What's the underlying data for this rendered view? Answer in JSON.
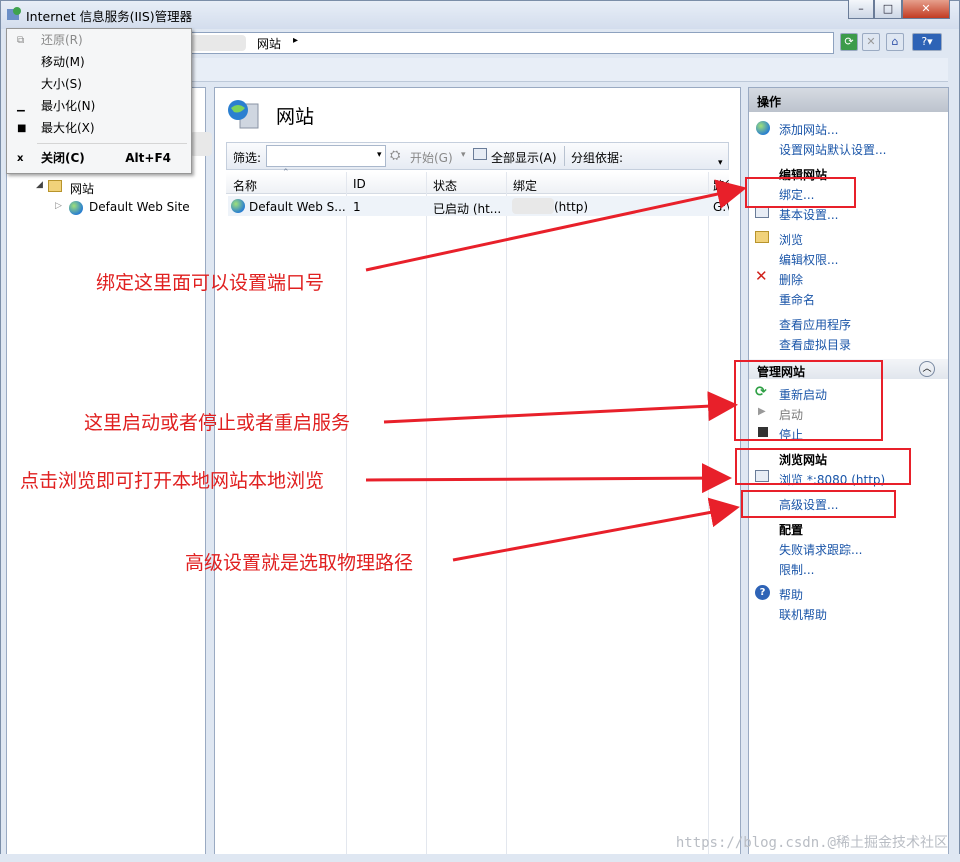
{
  "window": {
    "title": "Internet 信息服务(IIS)管理器",
    "min": "–",
    "max": "□",
    "close": "✕"
  },
  "context_menu": {
    "items": [
      {
        "label": "还原(R)",
        "icon": "⧉",
        "disabled": true
      },
      {
        "label": "移动(M)",
        "icon": ""
      },
      {
        "label": "大小(S)",
        "icon": ""
      },
      {
        "label": "最小化(N)",
        "icon": "▁"
      },
      {
        "label": "最大化(X)",
        "icon": "■"
      },
      {
        "label": "关闭(C)",
        "icon": "x",
        "accelerator": "Alt+F4",
        "bold": true
      }
    ]
  },
  "address": {
    "breadcrumb": "网站",
    "arrow": "▸"
  },
  "tree": {
    "sites_node": "网站",
    "site": "Default Web Site"
  },
  "center": {
    "title": "网站",
    "filter_label": "筛选:",
    "start_btn": "开始(G)",
    "show_all_btn": "全部显示(A)",
    "group_label": "分组依据:",
    "columns": [
      "名称",
      "ID",
      "状态",
      "绑定",
      "路径"
    ],
    "rows": [
      {
        "name": "Default Web S...",
        "id": "1",
        "status": "已启动 (ht...",
        "binding": "(http)",
        "path": "G:\\"
      }
    ]
  },
  "actions": {
    "header": "操作",
    "add_site": "添加网站...",
    "set_defaults": "设置网站默认设置...",
    "edit_site_header": "编辑网站",
    "bindings": "绑定...",
    "basic_settings": "基本设置...",
    "explore": "浏览",
    "edit_permissions": "编辑权限...",
    "delete": "删除",
    "rename": "重命名",
    "view_apps": "查看应用程序",
    "view_vdirs": "查看虚拟目录",
    "manage_header": "管理网站",
    "restart": "重新启动",
    "start": "启动",
    "stop": "停止",
    "browse_header": "浏览网站",
    "browse_link": "浏览 *:8080 (http)",
    "advanced": "高级设置...",
    "config_header": "配置",
    "failed_tracing": "失败请求跟踪...",
    "limits": "限制...",
    "help": "帮助",
    "online_help": "联机帮助"
  },
  "annotations": {
    "a1": "绑定这里面可以设置端口号",
    "a2": "这里启动或者停止或者重启服务",
    "a3": "点击浏览即可打开本地网站本地浏览",
    "a4": "高级设置就是选取物理路径"
  },
  "watermark": "https://blog.csdn.@稀土掘金技术社区",
  "colors": {
    "link": "#1a55a8",
    "annotation": "#e02020"
  }
}
